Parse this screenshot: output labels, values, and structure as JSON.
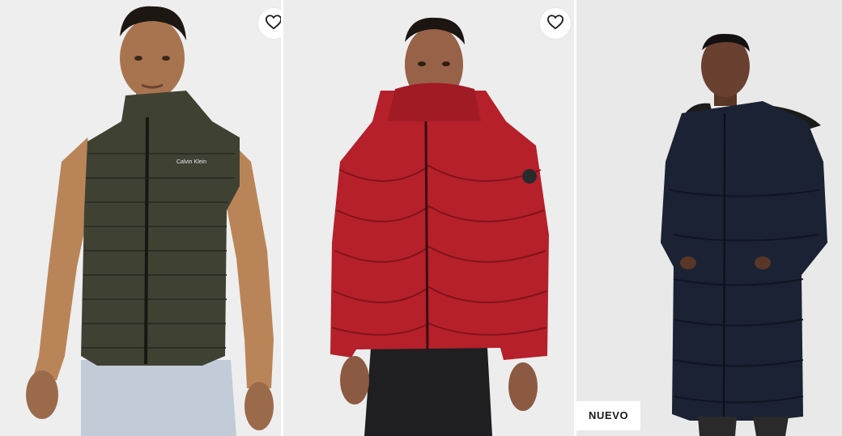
{
  "products": [
    {
      "id": "green-vest",
      "brand_print": "Calvin Klein",
      "wishlist_icon": "heart-outline-icon",
      "badge": null
    },
    {
      "id": "red-puffer",
      "brand_print": "",
      "wishlist_icon": "heart-outline-icon",
      "badge": null
    },
    {
      "id": "navy-parka",
      "brand_print": "",
      "wishlist_icon": null,
      "badge": "NUEVO"
    }
  ],
  "colors": {
    "card_bg_1": "#eeeeee",
    "card_bg_2": "#ededed",
    "card_bg_3": "#e9e9e9",
    "vest": "#3f4233",
    "sweater": "#b98558",
    "red_jacket": "#b5202b",
    "navy_coat": "#1b2233"
  }
}
